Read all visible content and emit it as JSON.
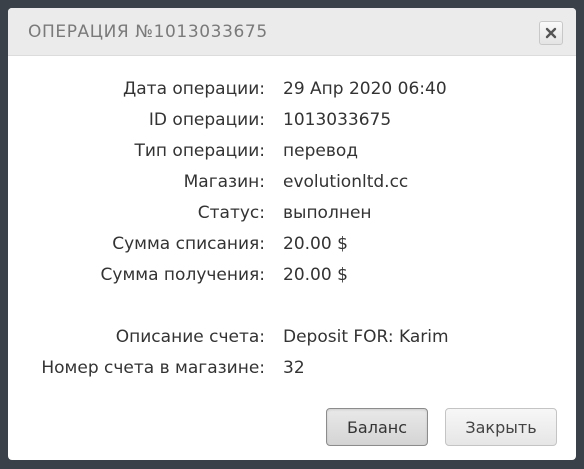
{
  "dialog": {
    "title": "ОПЕРАЦИЯ №1013033675",
    "close_icon": "close-x-icon"
  },
  "details": [
    {
      "label": "Дата операции:",
      "value": "29 Апр 2020 06:40"
    },
    {
      "label": "ID операции:",
      "value": "1013033675"
    },
    {
      "label": "Тип операции:",
      "value": "перевод"
    },
    {
      "label": "Магазин:",
      "value": "evolutionltd.cc"
    },
    {
      "label": "Статус:",
      "value": "выполнен"
    },
    {
      "label": "Сумма списания:",
      "value": "20.00 $"
    },
    {
      "label": "Сумма получения:",
      "value": "20.00 $"
    }
  ],
  "extra": [
    {
      "label": "Описание счета:",
      "value": "Deposit FOR: Karim"
    },
    {
      "label": "Номер счета в магазине:",
      "value": "32"
    }
  ],
  "buttons": {
    "balance": "Баланс",
    "close": "Закрыть"
  },
  "colors": {
    "backdrop": "#3a4148",
    "header_bg": "#ebebeb",
    "title_text": "#7a7a7a",
    "body_text": "#333333"
  }
}
